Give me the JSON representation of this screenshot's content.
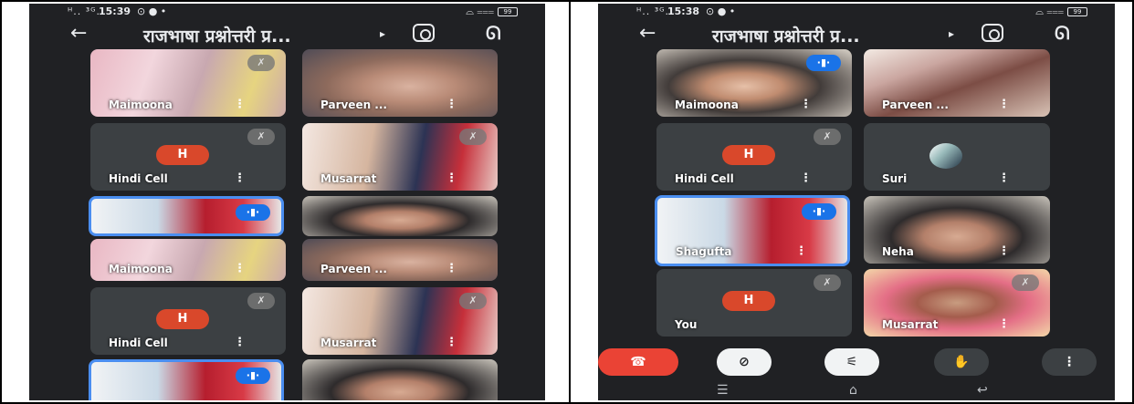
{
  "left": {
    "status": {
      "signal": "ᴴ.. ³ᴳ..",
      "time": "15:39",
      "icons": "⊙ ● •",
      "right": "⌓ ⩶",
      "battery": "99"
    },
    "meeting_title": "राजभाषा प्रश्नोत्तरी प्र...",
    "tiles": [
      {
        "name": "Maimoona"
      },
      {
        "name": "Parveen ..."
      },
      {
        "name": "Hindi Cell",
        "avatar": "H"
      },
      {
        "name": "Musarrat"
      },
      {
        "name": ""
      },
      {
        "name": ""
      },
      {
        "name": "Maimoona"
      },
      {
        "name": "Parveen ..."
      },
      {
        "name": "Hindi Cell",
        "avatar": "H"
      },
      {
        "name": "Musarrat"
      },
      {
        "name": ""
      },
      {
        "name": ""
      }
    ]
  },
  "right": {
    "status": {
      "signal": "ᴴ.. ³ᴳ..",
      "time": "15:38",
      "icons": "⊙ ● •",
      "right": "⌓ ⩶",
      "battery": "99"
    },
    "meeting_title": "राजभाषा प्रश्नोत्तरी प्र...",
    "tiles": [
      {
        "name": "Maimoona"
      },
      {
        "name": "Parveen ..."
      },
      {
        "name": "Hindi Cell",
        "avatar": "H"
      },
      {
        "name": "Suri"
      },
      {
        "name": "Shagufta"
      },
      {
        "name": "Neha"
      },
      {
        "name": "You",
        "avatar": "H"
      },
      {
        "name": "Musarrat"
      }
    ],
    "controls": {
      "end": "☎",
      "camera": "⊘",
      "mic": "⚟",
      "hand": "✋",
      "more": "⋮"
    },
    "nav": {
      "recents": "☰",
      "home": "⌂",
      "back": "↩"
    }
  },
  "ui": {
    "back_arrow": "←",
    "caret": "▸",
    "audio": "ᘏ",
    "kebab": "⋮",
    "mute": "✗",
    "speaking": "·▮·"
  }
}
